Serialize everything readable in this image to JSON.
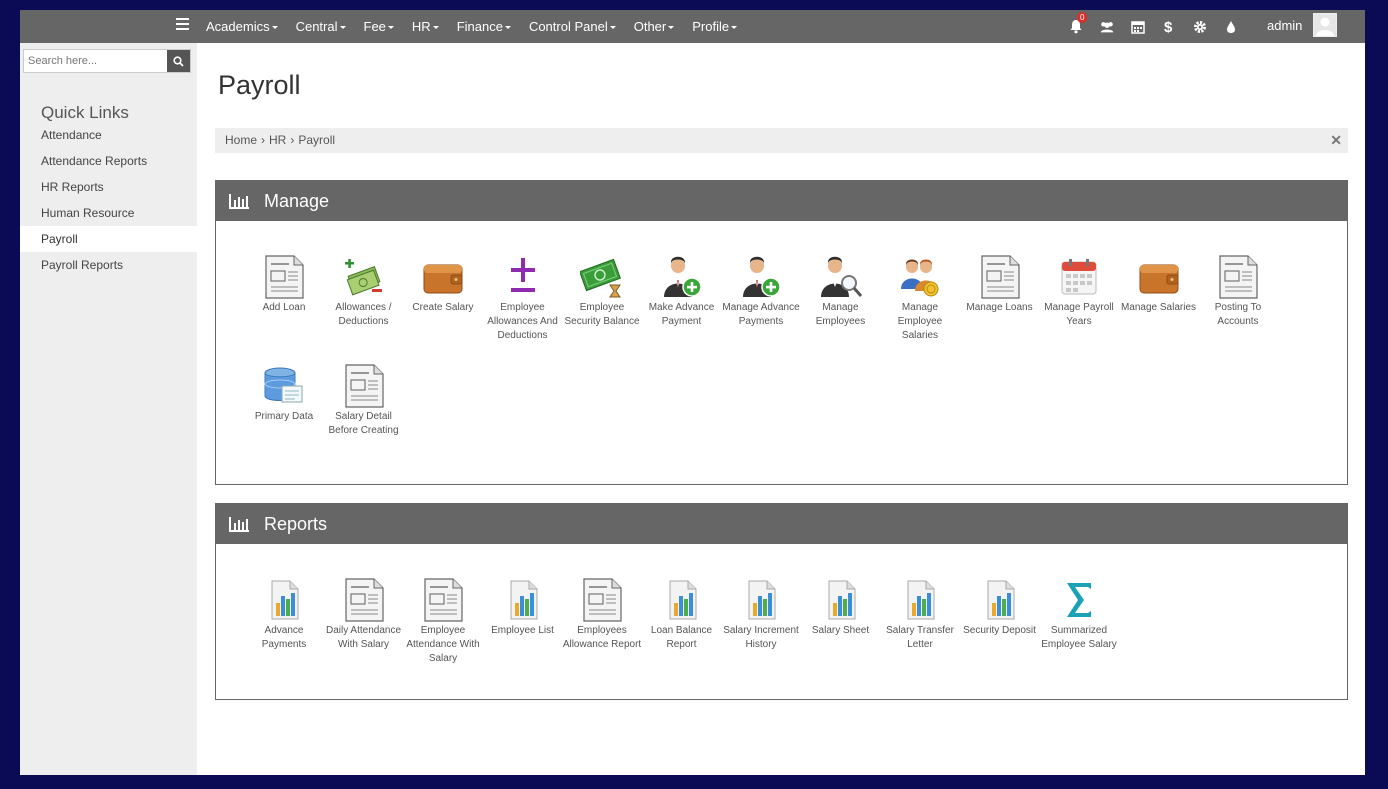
{
  "nav": {
    "menu": [
      "Academics",
      "Central",
      "Fee",
      "HR",
      "Finance",
      "Control Panel",
      "Other",
      "Profile"
    ],
    "notification_count": "0",
    "user": "admin"
  },
  "sidebar": {
    "search_placeholder": "Search here...",
    "title": "Quick Links",
    "items": [
      "Attendance",
      "Attendance Reports",
      "HR Reports",
      "Human Resource",
      "Payroll",
      "Payroll Reports"
    ],
    "active": "Payroll"
  },
  "page": {
    "title": "Payroll",
    "breadcrumb": [
      "Home",
      "HR",
      "Payroll"
    ]
  },
  "manage": {
    "title": "Manage",
    "tiles": [
      {
        "label": "Add Loan",
        "icon": "document-icon"
      },
      {
        "label": "Allowances / Deductions",
        "icon": "money-plus-minus-icon"
      },
      {
        "label": "Create Salary",
        "icon": "wallet-icon"
      },
      {
        "label": "Employee Allowances And Deductions",
        "icon": "plus-minus-icon"
      },
      {
        "label": "Employee Security Balance",
        "icon": "cash-hourglass-icon"
      },
      {
        "label": "Make Advance Payment",
        "icon": "user-add-icon"
      },
      {
        "label": "Manage Advance Payments",
        "icon": "user-add-icon"
      },
      {
        "label": "Manage Employees",
        "icon": "user-search-icon"
      },
      {
        "label": "Manage Employee Salaries",
        "icon": "users-coin-icon"
      },
      {
        "label": "Manage Loans",
        "icon": "document-icon"
      },
      {
        "label": "Manage Payroll Years",
        "icon": "calendar-icon"
      },
      {
        "label": "Manage Salaries",
        "icon": "wallet-icon"
      },
      {
        "label": "Posting To Accounts",
        "icon": "document-icon"
      },
      {
        "label": "Primary Data",
        "icon": "database-icon"
      },
      {
        "label": "Salary Detail Before Creating",
        "icon": "document-icon"
      }
    ]
  },
  "reports": {
    "title": "Reports",
    "tiles": [
      {
        "label": "Advance Payments",
        "icon": "bar-report-icon"
      },
      {
        "label": "Daily Attendance With Salary",
        "icon": "document-icon"
      },
      {
        "label": "Employee Attendance With Salary",
        "icon": "document-icon"
      },
      {
        "label": "Employee List",
        "icon": "bar-report-icon"
      },
      {
        "label": "Employees Allowance Report",
        "icon": "document-icon"
      },
      {
        "label": "Loan Balance Report",
        "icon": "bar-report-icon"
      },
      {
        "label": "Salary Increment History",
        "icon": "bar-report-icon"
      },
      {
        "label": "Salary Sheet",
        "icon": "bar-report-icon"
      },
      {
        "label": "Salary Transfer Letter",
        "icon": "bar-report-icon"
      },
      {
        "label": "Security Deposit",
        "icon": "bar-report-icon"
      },
      {
        "label": "Summarized Employee Salary",
        "icon": "sigma-icon"
      }
    ]
  },
  "colors": {
    "navbar": "#666666",
    "sidebar": "#eeeeee",
    "page_background": "#0b0b55",
    "sigma": "#1aa3b5",
    "plus_minus": "#8e2bb0"
  }
}
